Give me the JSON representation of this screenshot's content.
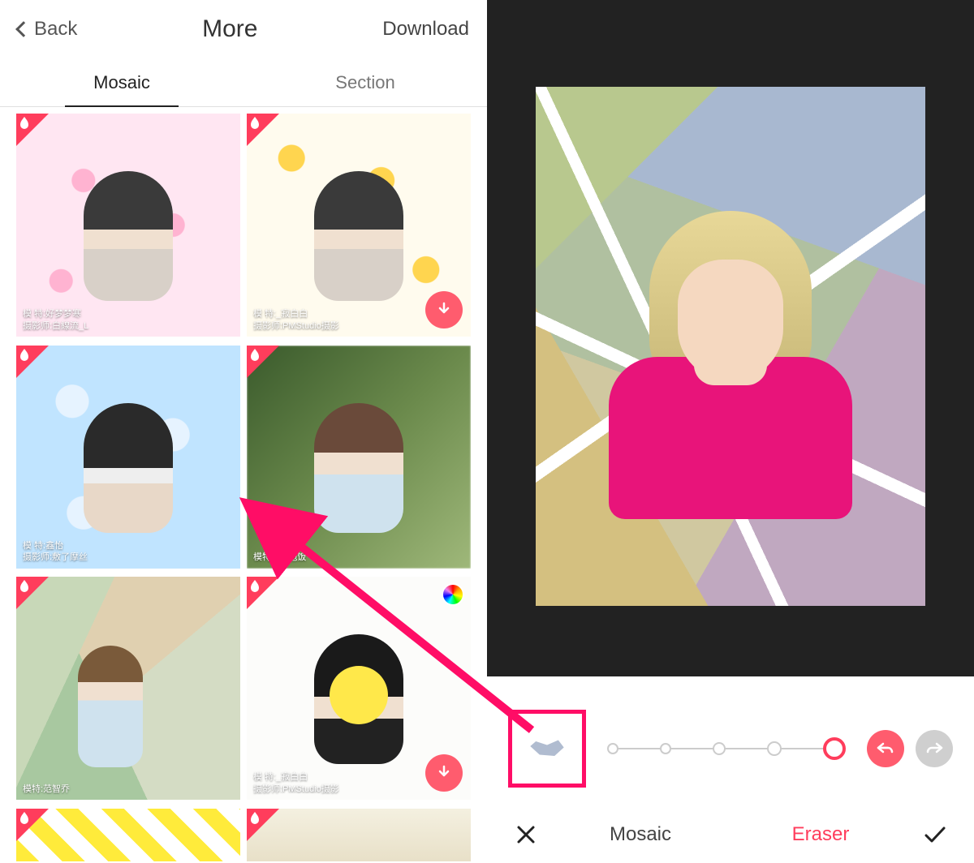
{
  "left": {
    "back_label": "Back",
    "title": "More",
    "download_label": "Download",
    "tabs": {
      "mosaic": "Mosaic",
      "section": "Section"
    },
    "tiles": [
      {
        "caption": "模  特:好梦梦寒\n摄影师:白線流_L"
      },
      {
        "caption": "模  特:_寂白白\n摄影师:PMStudio摄影"
      },
      {
        "caption": "模  特:鑫怡\n摄影师:敷了摩丝"
      },
      {
        "caption": "模特:___泡饭"
      },
      {
        "caption": "模特:范智乔"
      },
      {
        "caption": "模  特:_寂白白\n摄影师:PMStudio摄影"
      },
      {
        "caption": ""
      },
      {
        "caption": ""
      }
    ]
  },
  "right": {
    "toolbar": {
      "brush_sizes": 5,
      "selected_index": 4
    },
    "tabs": {
      "mosaic": "Mosaic",
      "eraser": "Eraser"
    }
  },
  "colors": {
    "accent": "#ff3d5c",
    "annotation": "#ff0d66"
  }
}
